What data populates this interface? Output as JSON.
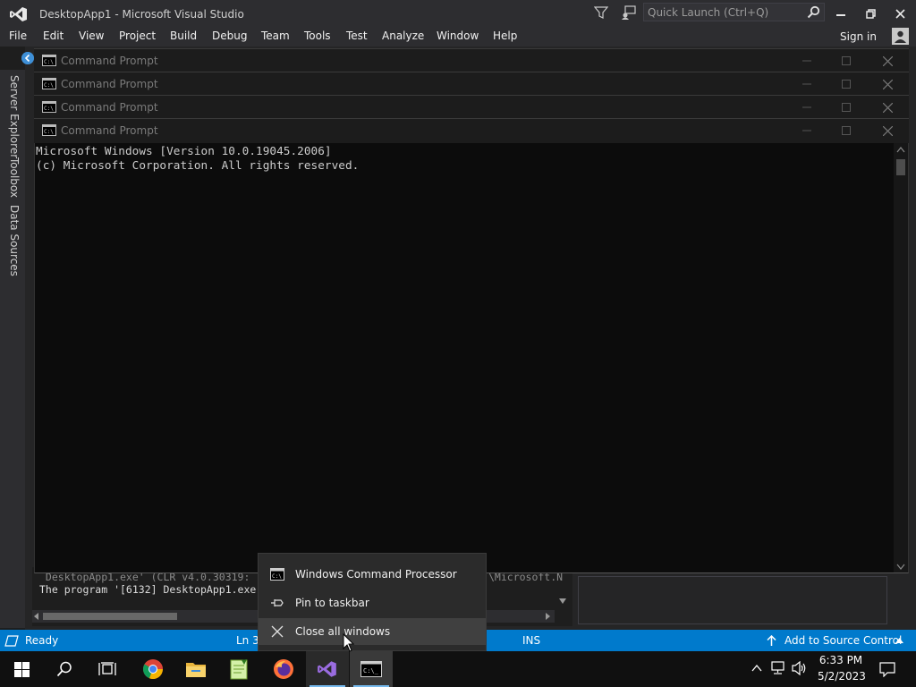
{
  "app": {
    "title": "DesktopApp1 - Microsoft Visual Studio",
    "quick_launch_placeholder": "Quick Launch (Ctrl+Q)"
  },
  "menu": {
    "items": [
      "File",
      "Edit",
      "View",
      "Project",
      "Build",
      "Debug",
      "Team",
      "Tools",
      "Test",
      "Analyze",
      "Window",
      "Help"
    ],
    "sign_in": "Sign in"
  },
  "side_tabs": [
    "Server Explorer",
    "Toolbox",
    "Data Sources"
  ],
  "cmd_windows": [
    {
      "title": "Command Prompt"
    },
    {
      "title": "Command Prompt"
    },
    {
      "title": "Command Prompt"
    },
    {
      "title": "Command Prompt"
    }
  ],
  "console": {
    "lines": [
      "Microsoft Windows [Version 10.0.19045.2006]",
      "(c) Microsoft Corporation. All rights reserved."
    ]
  },
  "output": {
    "lines": [
      " DesktopApp1.exe' (CLR v4.0.30319:",
      "The program '[6132] DesktopApp1.exe"
    ],
    "right_fragment": "\\Microsoft.N"
  },
  "status": {
    "ready": "Ready",
    "ln": "Ln 3",
    "ins": "INS",
    "source_control": "Add to Source Control"
  },
  "jumplist": {
    "items": [
      {
        "label": "Windows Command Processor",
        "icon": "cmd-icon"
      },
      {
        "label": "Pin to taskbar",
        "icon": "pin-icon"
      },
      {
        "label": "Close all windows",
        "icon": "close-icon"
      }
    ]
  },
  "taskbar": {
    "time": "6:33 PM",
    "date": "5/2/2023"
  },
  "colors": {
    "status_bar": "#007acc",
    "title_bar": "#2d2d30",
    "console_bg": "#0c0c0c"
  }
}
